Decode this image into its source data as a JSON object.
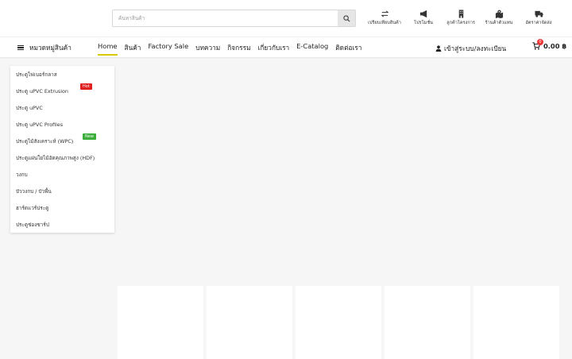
{
  "search": {
    "placeholder": "ค้นหาสินค้า"
  },
  "quick_links": [
    {
      "label": "เปรียบเทียบสินค้า",
      "icon": "compare-icon"
    },
    {
      "label": "โปรโมชั่น",
      "icon": "megaphone-icon"
    },
    {
      "label": "ลูกค้าโครงการ",
      "icon": "building-icon"
    },
    {
      "label": "ร้านค้าตัวแทน",
      "icon": "map-location-icon"
    },
    {
      "label": "อัตราค่าจัดส่ง",
      "icon": "truck-icon"
    }
  ],
  "nav": {
    "category_label": "หมวดหมู่สินค้า",
    "menu": [
      "Home",
      "สินค้า",
      "Factory Sale",
      "บทความ",
      "กิจกรรม",
      "เกี่ยวกับเรา",
      "E-Catalog",
      "ติดต่อเรา"
    ],
    "active_index": 0,
    "login_label": "เข้าสู่ระบบ/ลงทะเบียน",
    "cart_count": "0",
    "cart_total": "0.00 ฿"
  },
  "categories": [
    {
      "label": "ประตูไฟเบอร์กลาส",
      "tag": ""
    },
    {
      "label": "ประตู uPVC Extrusion",
      "tag": "Hot"
    },
    {
      "label": "ประตู uPVC",
      "tag": ""
    },
    {
      "label": "ประตู uPVC Profiles",
      "tag": ""
    },
    {
      "label": "ประตูไม้สังเคราะห์ (WPC)",
      "tag": "New"
    },
    {
      "label": "ประตูแผ่นใยไม้อัดคุณภาพสูง (HDF)",
      "tag": ""
    },
    {
      "label": "วงกบ",
      "tag": ""
    },
    {
      "label": "บัววงกบ / บัวพื้น",
      "tag": ""
    },
    {
      "label": "ฮาร์ดแวร์ประตู",
      "tag": ""
    },
    {
      "label": "ประตูช่องชาร์ป",
      "tag": ""
    }
  ],
  "colors": {
    "accent_underline": "#d7c800",
    "hot": "#e02020",
    "new": "#3aad3a",
    "cart_badge": "#e33333"
  }
}
